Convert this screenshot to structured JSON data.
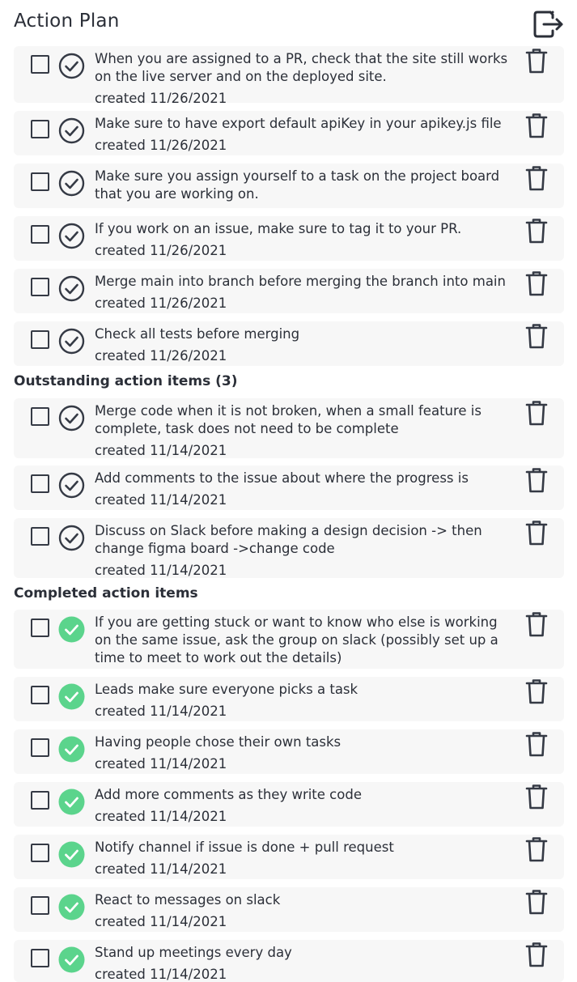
{
  "header": {
    "title": "Action Plan",
    "logout_icon": "logout-icon"
  },
  "colors": {
    "completed": "#5bd48c",
    "text": "#2b2f38",
    "card": "#f7f7f7"
  },
  "top_items": [
    {
      "text": "When you are assigned to a PR, check that the site still works on the live server and on the deployed site.",
      "created": "created 11/26/2021"
    },
    {
      "text": "Make sure to have export default apiKey in your apikey.js file",
      "created": "created 11/26/2021"
    },
    {
      "text": "Make sure you assign yourself to a task on the project board that you are working on.",
      "created": ""
    },
    {
      "text": "If you work on an issue, make sure to tag it to your PR.",
      "created": "created 11/26/2021"
    },
    {
      "text": "Merge main into branch before merging the branch into main",
      "created": "created 11/26/2021"
    },
    {
      "text": "Check all tests before merging",
      "created": "created 11/26/2021"
    }
  ],
  "outstanding": {
    "heading": "Outstanding action items (3)",
    "items": [
      {
        "text": "Merge code when it is not broken, when a small feature is complete, task does not need to be complete",
        "created": "created 11/14/2021"
      },
      {
        "text": "Add comments to the issue about where the progress is",
        "created": "created 11/14/2021"
      },
      {
        "text": "Discuss on Slack before making a design decision -> then change figma board ->change code",
        "created": "created 11/14/2021"
      }
    ]
  },
  "completed": {
    "heading": "Completed action items",
    "items": [
      {
        "text": "If you are getting stuck or want to know who else is working on the same issue, ask the group on slack (possibly set up a time to meet to work out the details)",
        "created": ""
      },
      {
        "text": "Leads make sure everyone picks a task",
        "created": "created 11/14/2021"
      },
      {
        "text": "Having people chose their own tasks",
        "created": "created 11/14/2021"
      },
      {
        "text": "Add more comments as they write code",
        "created": "created 11/14/2021"
      },
      {
        "text": "Notify channel if issue is done + pull request",
        "created": "created 11/14/2021"
      },
      {
        "text": "React to messages on slack",
        "created": "created 11/14/2021"
      },
      {
        "text": "Stand up meetings every day",
        "created": "created 11/14/2021"
      }
    ]
  }
}
